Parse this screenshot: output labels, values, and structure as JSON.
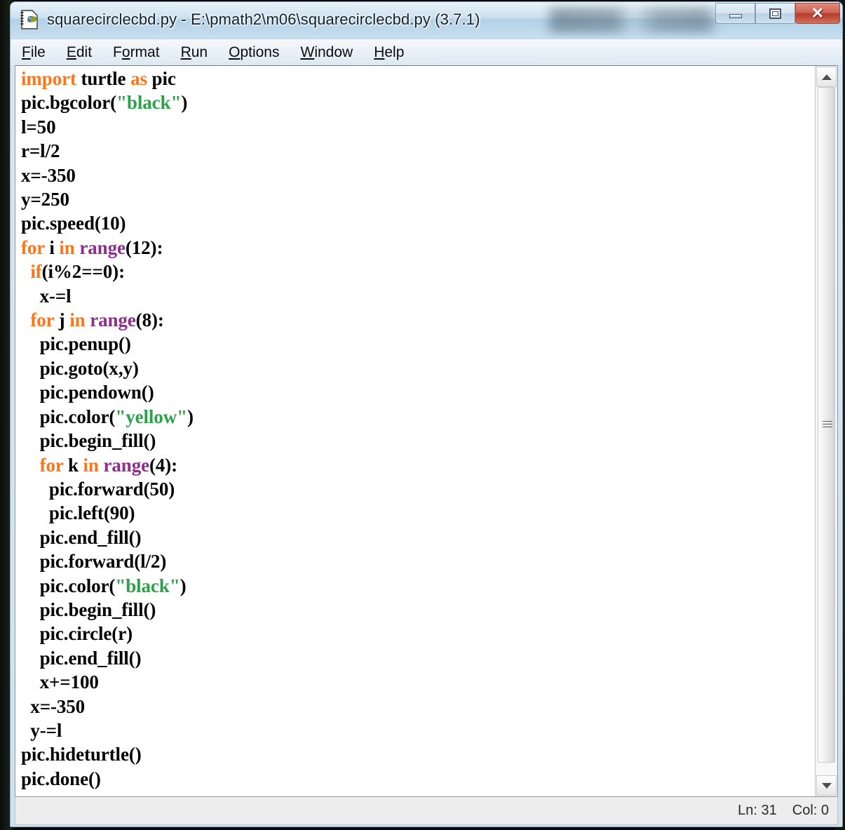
{
  "window": {
    "title": "squarecirclecbd.py - E:\\pmath2\\m06\\squarecirclecbd.py (3.7.1)",
    "icon": "idle-python-file-icon",
    "controls": {
      "minimize": "minimize-icon",
      "maximize": "maximize-icon",
      "close": "✕"
    }
  },
  "menubar": {
    "items": [
      {
        "label": "File",
        "mnemonic": "F",
        "pre": "",
        "post": "ile"
      },
      {
        "label": "Edit",
        "mnemonic": "E",
        "pre": "",
        "post": "dit"
      },
      {
        "label": "Format",
        "mnemonic": "o",
        "pre": "F",
        "post": "rmat"
      },
      {
        "label": "Run",
        "mnemonic": "R",
        "pre": "",
        "post": "un"
      },
      {
        "label": "Options",
        "mnemonic": "O",
        "pre": "",
        "post": "ptions"
      },
      {
        "label": "Window",
        "mnemonic": "W",
        "pre": "",
        "post": "indow"
      },
      {
        "label": "Help",
        "mnemonic": "H",
        "pre": "",
        "post": "elp"
      }
    ]
  },
  "editor": {
    "language": "python",
    "colors": {
      "keyword": "#ff7518",
      "builtin": "#8c2f8c",
      "string": "#2ba14a",
      "plain": "#000000",
      "background": "#ffffff"
    },
    "lines": [
      [
        {
          "t": "import",
          "c": "kw"
        },
        {
          "t": " turtle ",
          "c": "pl"
        },
        {
          "t": "as",
          "c": "kw"
        },
        {
          "t": " pic",
          "c": "pl"
        }
      ],
      [
        {
          "t": "pic.bgcolor(",
          "c": "pl"
        },
        {
          "t": "\"black\"",
          "c": "str"
        },
        {
          "t": ")",
          "c": "pl"
        }
      ],
      [
        {
          "t": "l=50",
          "c": "pl"
        }
      ],
      [
        {
          "t": "r=l/2",
          "c": "pl"
        }
      ],
      [
        {
          "t": "x=-350",
          "c": "pl"
        }
      ],
      [
        {
          "t": "y=250",
          "c": "pl"
        }
      ],
      [
        {
          "t": "pic.speed(10)",
          "c": "pl"
        }
      ],
      [
        {
          "t": "for",
          "c": "kw"
        },
        {
          "t": " i ",
          "c": "pl"
        },
        {
          "t": "in",
          "c": "kw"
        },
        {
          "t": " ",
          "c": "pl"
        },
        {
          "t": "range",
          "c": "bi"
        },
        {
          "t": "(12):",
          "c": "pl"
        }
      ],
      [
        {
          "t": "  ",
          "c": "pl"
        },
        {
          "t": "if",
          "c": "kw"
        },
        {
          "t": "(i%2==0):",
          "c": "pl"
        }
      ],
      [
        {
          "t": "    x-=l",
          "c": "pl"
        }
      ],
      [
        {
          "t": "  ",
          "c": "pl"
        },
        {
          "t": "for",
          "c": "kw"
        },
        {
          "t": " j ",
          "c": "pl"
        },
        {
          "t": "in",
          "c": "kw"
        },
        {
          "t": " ",
          "c": "pl"
        },
        {
          "t": "range",
          "c": "bi"
        },
        {
          "t": "(8):",
          "c": "pl"
        }
      ],
      [
        {
          "t": "    pic.penup()",
          "c": "pl"
        }
      ],
      [
        {
          "t": "    pic.goto(x,y)",
          "c": "pl"
        }
      ],
      [
        {
          "t": "    pic.pendown()",
          "c": "pl"
        }
      ],
      [
        {
          "t": "    pic.color(",
          "c": "pl"
        },
        {
          "t": "\"yellow\"",
          "c": "str"
        },
        {
          "t": ")",
          "c": "pl"
        }
      ],
      [
        {
          "t": "    pic.begin_fill()",
          "c": "pl"
        }
      ],
      [
        {
          "t": "    ",
          "c": "pl"
        },
        {
          "t": "for",
          "c": "kw"
        },
        {
          "t": " k ",
          "c": "pl"
        },
        {
          "t": "in",
          "c": "kw"
        },
        {
          "t": " ",
          "c": "pl"
        },
        {
          "t": "range",
          "c": "bi"
        },
        {
          "t": "(4):",
          "c": "pl"
        }
      ],
      [
        {
          "t": "      pic.forward(50)",
          "c": "pl"
        }
      ],
      [
        {
          "t": "      pic.left(90)",
          "c": "pl"
        }
      ],
      [
        {
          "t": "    pic.end_fill()",
          "c": "pl"
        }
      ],
      [
        {
          "t": "    pic.forward(l/2)",
          "c": "pl"
        }
      ],
      [
        {
          "t": "    pic.color(",
          "c": "pl"
        },
        {
          "t": "\"black\"",
          "c": "str"
        },
        {
          "t": ")",
          "c": "pl"
        }
      ],
      [
        {
          "t": "    pic.begin_fill()",
          "c": "pl"
        }
      ],
      [
        {
          "t": "    pic.circle(r)",
          "c": "pl"
        }
      ],
      [
        {
          "t": "    pic.end_fill()",
          "c": "pl"
        }
      ],
      [
        {
          "t": "    x+=100",
          "c": "pl"
        }
      ],
      [
        {
          "t": "  x=-350",
          "c": "pl"
        }
      ],
      [
        {
          "t": "  y-=l",
          "c": "pl"
        }
      ],
      [
        {
          "t": "pic.hideturtle()",
          "c": "pl"
        }
      ],
      [
        {
          "t": "pic.done()",
          "c": "pl"
        }
      ]
    ]
  },
  "scrollbar": {
    "up_arrow": "chevron-up-icon",
    "down_arrow": "chevron-down-icon",
    "grip": "grip-lines-icon"
  },
  "statusbar": {
    "line": "Ln: 31",
    "column": "Col: 0"
  }
}
